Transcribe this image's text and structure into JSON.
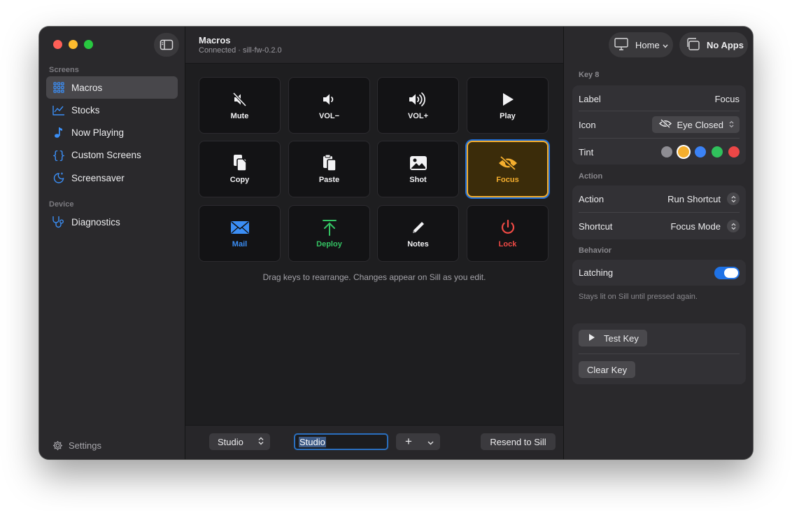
{
  "sidebar": {
    "section_screens": "Screens",
    "items": [
      {
        "label": "Macros",
        "icon": "grid-icon",
        "active": true
      },
      {
        "label": "Stocks",
        "icon": "chart-line-icon"
      },
      {
        "label": "Now Playing",
        "icon": "music-note-icon"
      },
      {
        "label": "Custom Screens",
        "icon": "braces-icon"
      },
      {
        "label": "Screensaver",
        "icon": "moon-sparkle-icon"
      }
    ],
    "section_device": "Device",
    "device_items": [
      {
        "label": "Diagnostics",
        "icon": "stethoscope-icon"
      }
    ],
    "settings_label": "Settings"
  },
  "header": {
    "title": "Macros",
    "subtitle": "Connected · sill-fw-0.2.0"
  },
  "keys": [
    {
      "label": "Mute",
      "icon": "speaker-slash-icon",
      "color": "#f2f2f4"
    },
    {
      "label": "VOL−",
      "icon": "speaker-low-icon",
      "color": "#f2f2f4"
    },
    {
      "label": "VOL+",
      "icon": "speaker-high-icon",
      "color": "#f2f2f4"
    },
    {
      "label": "Play",
      "icon": "play-icon",
      "color": "#f2f2f4"
    },
    {
      "label": "Copy",
      "icon": "copy-icon",
      "color": "#f2f2f4"
    },
    {
      "label": "Paste",
      "icon": "paste-icon",
      "color": "#f2f2f4"
    },
    {
      "label": "Shot",
      "icon": "photo-icon",
      "color": "#f2f2f4"
    },
    {
      "label": "Focus",
      "icon": "eye-slash-icon",
      "color": "#f4ae2e",
      "selected": true
    },
    {
      "label": "Mail",
      "icon": "envelope-icon",
      "color": "#3b8ef5"
    },
    {
      "label": "Deploy",
      "icon": "arrow-up-to-line-icon",
      "color": "#34c363"
    },
    {
      "label": "Notes",
      "icon": "pencil-icon",
      "color": "#f2f2f4"
    },
    {
      "label": "Lock",
      "icon": "power-icon",
      "color": "#f04a45"
    }
  ],
  "hint": "Drag keys to rearrange. Changes appear on Sill as you edit.",
  "bottom": {
    "profile_select": "Studio",
    "profile_name_value": "Studio",
    "add_label": "+",
    "resend_label": "Resend to Sill"
  },
  "toolbar": {
    "home_label": "Home",
    "apps_label": "No Apps"
  },
  "inspector": {
    "key_title": "Key 8",
    "label_field": "Label",
    "label_value": "Focus",
    "icon_field": "Icon",
    "icon_value": "Eye Closed",
    "tint_field": "Tint",
    "tints": [
      "#8e8d93",
      "#f4ae2e",
      "#3b82f6",
      "#30c15c",
      "#ec4747"
    ],
    "selected_tint": 1,
    "action_section": "Action",
    "action_field": "Action",
    "action_value": "Run Shortcut",
    "shortcut_field": "Shortcut",
    "shortcut_value": "Focus Mode",
    "behavior_section": "Behavior",
    "latching_field": "Latching",
    "latching_on": true,
    "latching_note": "Stays lit on Sill until pressed again.",
    "test_key_label": "Test Key",
    "clear_key_label": "Clear Key"
  },
  "colors": {
    "accent": "#1f72e6",
    "selected_key_border": "#f3ad2e"
  }
}
